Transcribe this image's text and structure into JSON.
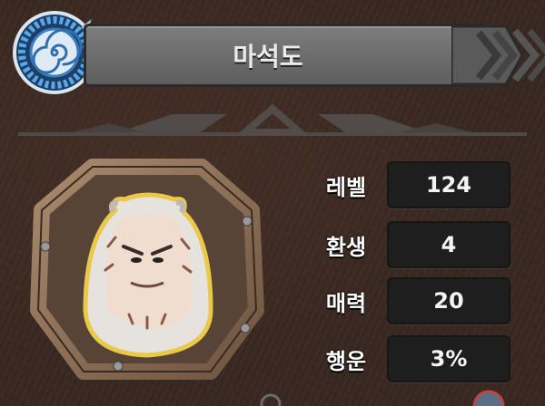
{
  "character": {
    "name": "마석도"
  },
  "icons": {
    "emblem": "spiral-badge-icon",
    "title_arrows": "chevron-right-icon",
    "divider": "ornamental-divider",
    "portrait": "character-portrait"
  },
  "stats": [
    {
      "label": "레벨",
      "value": "124"
    },
    {
      "label": "환생",
      "value": "4"
    },
    {
      "label": "매력",
      "value": "20"
    },
    {
      "label": "행운",
      "value": "3%"
    }
  ]
}
